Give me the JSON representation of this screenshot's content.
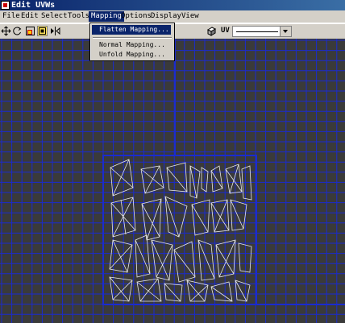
{
  "window": {
    "title": "Edit UVWs"
  },
  "menubar": {
    "items": [
      "File",
      "Edit",
      "Select",
      "Tools",
      "Mapping",
      "Options",
      "Display",
      "View"
    ],
    "active": "Mapping"
  },
  "mapping_menu": {
    "items": [
      "Flatten Mapping...",
      "Normal Mapping...",
      "Unfold Mapping..."
    ],
    "highlighted": "Flatten Mapping..."
  },
  "toolbar": {
    "tools": [
      "move-icon",
      "rotate-icon",
      "scale-icon",
      "freeform-icon",
      "mirror-icon"
    ],
    "pressed_tool": "freeform-icon",
    "uv_label": "UV",
    "map_dropdown_value": ""
  },
  "colors": {
    "grid_line": "#1a2bd0",
    "background": "#3a3a3a",
    "uv_edges": "#e8e8e8",
    "highlight": "#0a246a"
  }
}
